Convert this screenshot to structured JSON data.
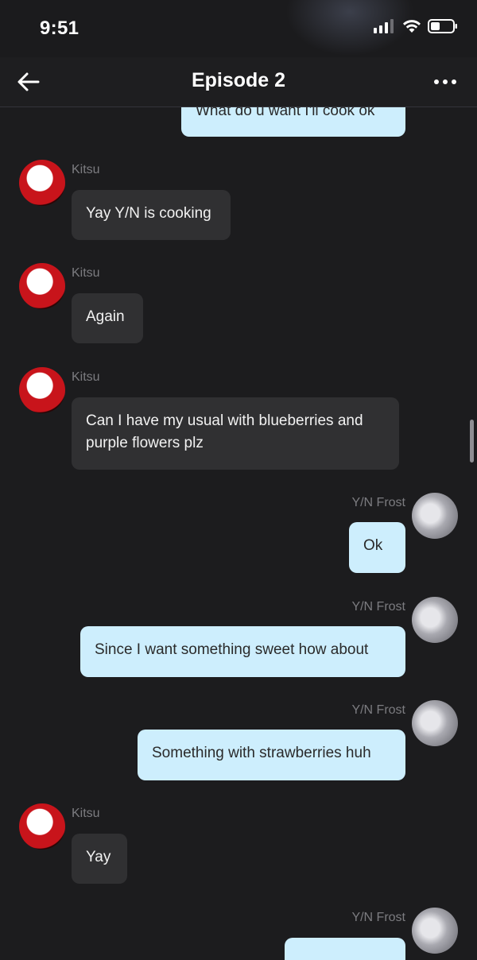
{
  "status_bar": {
    "time": "9:51",
    "icons": [
      "signal-icon",
      "wifi-icon",
      "battery-icon"
    ]
  },
  "header": {
    "title": "Episode 2",
    "back_icon": "arrow-left-icon",
    "more_icon": "more-icon"
  },
  "messages": [
    {
      "sender": "",
      "text": "What do u want I'll cook ok",
      "side": "right"
    },
    {
      "sender": "Kitsu",
      "text": "Yay Y/N is cooking",
      "side": "left"
    },
    {
      "sender": "Kitsu",
      "text": "Again",
      "side": "left"
    },
    {
      "sender": "Kitsu",
      "text": "Can I have my usual with blueberries and purple flowers plz",
      "side": "left"
    },
    {
      "sender": "Y/N Frost",
      "text": "Ok",
      "side": "right"
    },
    {
      "sender": "Y/N Frost",
      "text": "Since I want something sweet how about",
      "side": "right"
    },
    {
      "sender": "Y/N Frost",
      "text": "Something with strawberries huh",
      "side": "right"
    },
    {
      "sender": "Kitsu",
      "text": "Yay",
      "side": "left"
    },
    {
      "sender": "Y/N Frost",
      "text": "",
      "side": "right"
    }
  ],
  "colors": {
    "background": "#1c1c1e",
    "incoming_bubble": "#303032",
    "outgoing_bubble": "#cdeefd",
    "sender_name": "#7c7c80"
  }
}
